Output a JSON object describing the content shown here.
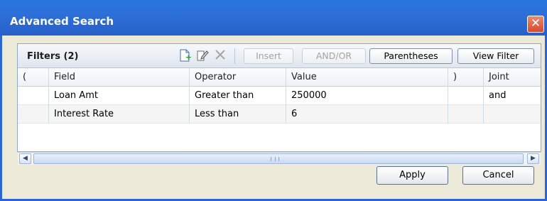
{
  "window": {
    "title": "Advanced Search",
    "close_glyph": "✕"
  },
  "panel": {
    "title": "Filters (2)",
    "icons": {
      "add": "add-filter-icon",
      "edit": "edit-filter-icon",
      "delete": "delete-filter-icon"
    },
    "toolbar": {
      "insert_label": "Insert",
      "andor_label": "AND/OR",
      "parentheses_label": "Parentheses",
      "view_filter_label": "View Filter"
    }
  },
  "grid": {
    "columns": [
      "(",
      "Field",
      "Operator",
      "Value",
      ")",
      "Joint"
    ],
    "rows": [
      [
        "",
        "Loan Amt",
        "Greater than",
        "250000",
        "",
        "and"
      ],
      [
        "",
        "Interest Rate",
        "Less than",
        "6",
        "",
        ""
      ]
    ]
  },
  "scrollbar": {
    "left_glyph": "◀",
    "right_glyph": "▶"
  },
  "footer": {
    "apply_label": "Apply",
    "cancel_label": "Cancel"
  },
  "colors": {
    "titlebar": "#2d6fd8",
    "dialog_bg": "#ece9d8",
    "close_button": "#d7492c"
  }
}
